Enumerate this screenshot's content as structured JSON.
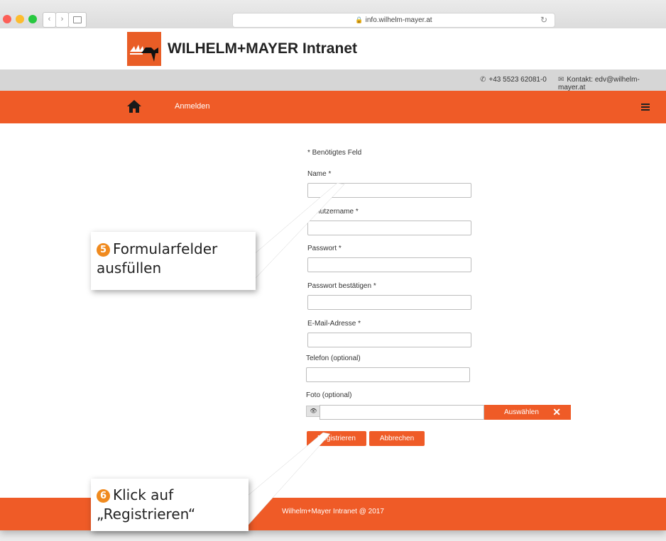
{
  "browser": {
    "url": "info.wilhelm-mayer.at",
    "back": "‹",
    "forward": "›"
  },
  "site": {
    "title": "WILHELM+MAYER Intranet",
    "phone": "+43 5523 62081-0",
    "contact": "Kontakt: edv@wilhelm-mayer.at"
  },
  "nav": {
    "link": "Anmelden"
  },
  "form": {
    "required_note": "* Benötigtes Feld",
    "fields": [
      {
        "label": "Name *",
        "value": ""
      },
      {
        "label": "Benutzername *",
        "value": ""
      },
      {
        "label": "Passwort *",
        "value": ""
      },
      {
        "label": "Passwort bestätigen *",
        "value": ""
      },
      {
        "label": "E-Mail-Adresse *",
        "value": ""
      },
      {
        "label": "Telefon (optional)",
        "value": ""
      }
    ],
    "photo_label": "Foto (optional)",
    "choose_button": "Auswählen",
    "register_button": "Registrieren",
    "cancel_button": "Abbrechen"
  },
  "footer": {
    "text": "Wilhelm+Mayer Intranet @ 2017"
  },
  "callouts": [
    {
      "number": "5",
      "line1": "Formularfelder",
      "line2": "ausfüllen"
    },
    {
      "number": "6",
      "line1": "Klick auf",
      "line2": "„Registrieren“"
    }
  ],
  "colors": {
    "brand_orange": "#ef5b27",
    "step_orange": "#f08a1e"
  }
}
